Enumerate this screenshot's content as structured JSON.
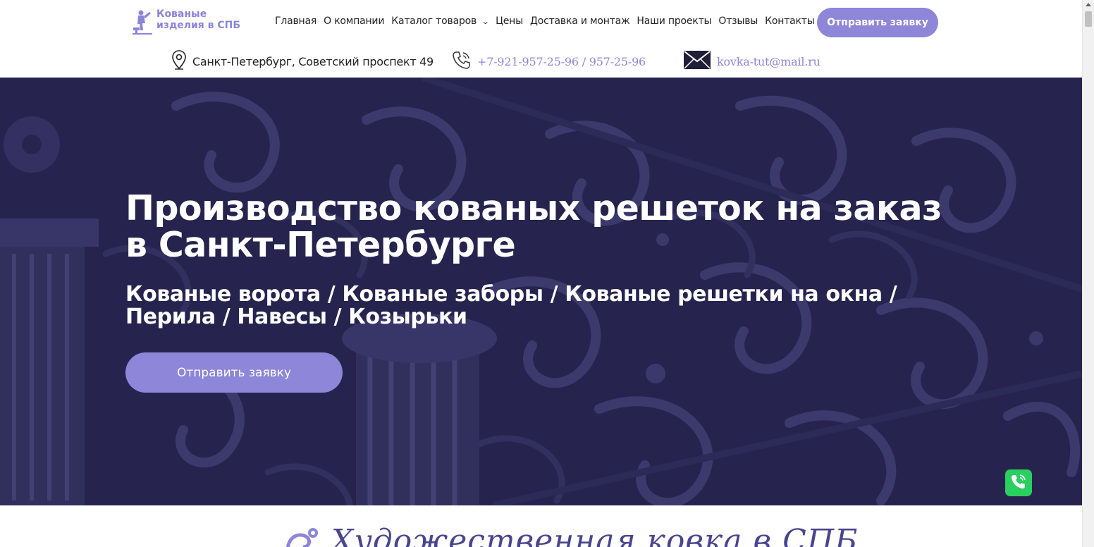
{
  "header": {
    "logo": {
      "line1": "Кованые",
      "line2": "изделия в СПБ"
    },
    "nav": [
      {
        "label": "Главная"
      },
      {
        "label": "О компании"
      },
      {
        "label": "Каталог товаров",
        "has_dropdown": true
      },
      {
        "label": "Цены"
      },
      {
        "label": "Доставка и монтаж"
      },
      {
        "label": "Наши проекты"
      },
      {
        "label": "Отзывы"
      },
      {
        "label": "Контакты"
      }
    ],
    "cta_label": "Отправить заявку",
    "address": "Санкт-Петербург, Советский проспект 49",
    "phone": "+7-921-957-25-96 / 957-25-96",
    "email": "kovka-tut@mail.ru"
  },
  "hero": {
    "title": "Производство кованых решеток на заказ в Санкт-Петербурге",
    "subtitle": "Кованые ворота / Кованые заборы / Кованые решетки на окна / Перила / Навесы / Козырьки",
    "cta_label": "Отправить заявку"
  },
  "section": {
    "heading": "Художественная ковка в СПБ"
  },
  "colors": {
    "accent": "#8d86d9",
    "hero_overlay": "#27264f",
    "call_button": "#2bcf5f"
  }
}
